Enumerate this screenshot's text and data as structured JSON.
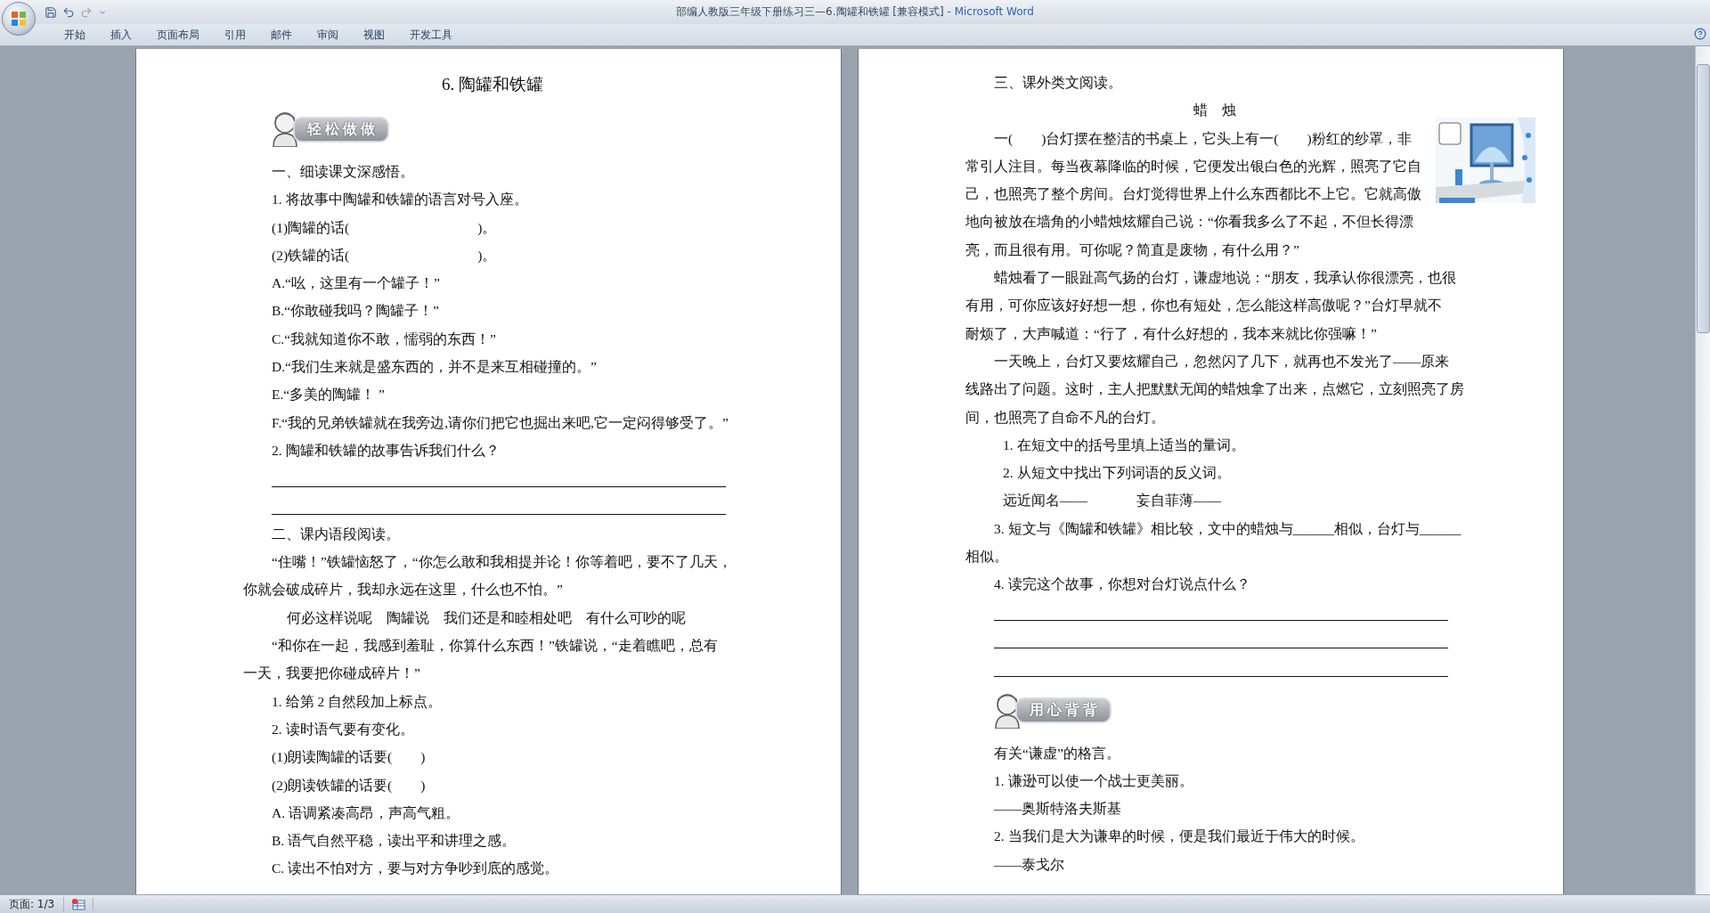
{
  "window": {
    "title": "部编人教版三年级下册练习三—6.陶罐和铁罐 [兼容模式]",
    "app_name": " - Microsoft Word"
  },
  "ribbon_tabs": [
    "开始",
    "插入",
    "页面布局",
    "引用",
    "邮件",
    "审阅",
    "视图",
    "开发工具"
  ],
  "pages": [
    {
      "blocks": [
        {
          "kind": "title",
          "text": "6. 陶罐和铁罐"
        },
        {
          "kind": "banner",
          "text": "轻松做做"
        },
        {
          "kind": "line",
          "text": "一、细读课文深感悟。"
        },
        {
          "kind": "line",
          "text": "1. 将故事中陶罐和铁罐的语言对号入座。"
        },
        {
          "kind": "line",
          "text": "(1)陶罐的话(　　　　　　　　　)。"
        },
        {
          "kind": "line",
          "text": "(2)铁罐的话(　　　　　　　　　)。"
        },
        {
          "kind": "line",
          "text": "A.“吆，这里有一个罐子！”"
        },
        {
          "kind": "line",
          "text": "B.“你敢碰我吗？陶罐子！”"
        },
        {
          "kind": "line",
          "text": "C.“我就知道你不敢，懦弱的东西！”"
        },
        {
          "kind": "line",
          "text": "D.“我们生来就是盛东西的，并不是来互相碰撞的。”"
        },
        {
          "kind": "line",
          "text": "E.“多美的陶罐！ ”"
        },
        {
          "kind": "line",
          "text": "F.“我的兄弟铁罐就在我旁边,请你们把它也掘出来吧,它一定闷得够受了。”"
        },
        {
          "kind": "line",
          "text": "2. 陶罐和铁罐的故事告诉我们什么？"
        },
        {
          "kind": "answer"
        },
        {
          "kind": "answer"
        },
        {
          "kind": "line",
          "text": "二、课内语段阅读。"
        },
        {
          "kind": "para",
          "lines": [
            "“住嘴！”铁罐恼怒了，“你怎么敢和我相提并论！你等着吧，要不了几天，",
            "你就会破成碎片，我却永远在这里，什么也不怕。”"
          ]
        },
        {
          "kind": "indented",
          "text": "何必这样说呢　陶罐说　我们还是和睦相处吧　有什么可吵的呢"
        },
        {
          "kind": "para",
          "lines": [
            "“和你在一起，我感到羞耻，你算什么东西！”铁罐说，“走着瞧吧，总有",
            "一天，我要把你碰成碎片！”"
          ]
        },
        {
          "kind": "line",
          "text": "1. 给第 2 自然段加上标点。"
        },
        {
          "kind": "line",
          "text": "2. 读时语气要有变化。"
        },
        {
          "kind": "line",
          "text": "(1)朗读陶罐的话要(　　)"
        },
        {
          "kind": "line",
          "text": "(2)朗读铁罐的话要(　　)"
        },
        {
          "kind": "line",
          "text": "A. 语调紧凑高昂，声高气粗。"
        },
        {
          "kind": "line",
          "text": "B. 语气自然平稳，读出平和讲理之感。"
        },
        {
          "kind": "line",
          "text": "C. 读出不怕对方，要与对方争吵到底的感觉。"
        }
      ]
    },
    {
      "blocks": [
        {
          "kind": "line",
          "text": "三、课外类文阅读。"
        },
        {
          "kind": "subtitle",
          "text": "蜡　烛"
        },
        {
          "kind": "picture_para",
          "lines": [
            "一(　　)台灯摆在整洁的书桌上，它头上有一(　　)粉红的纱罩，非",
            "常引人注目。每当夜幕降临的时候，它便发出银白色的光辉，照亮了它自",
            "己，也照亮了整个房间。台灯觉得世界上什么东西都比不上它。它就高傲",
            "地向被放在墙角的小蜡烛炫耀自己说：“你看我多么了不起，不但长得漂",
            "亮，而且很有用。可你呢？简直是废物，有什么用？”"
          ]
        },
        {
          "kind": "para",
          "lines": [
            "蜡烛看了一眼趾高气扬的台灯，谦虚地说：“朋友，我承认你很漂亮，也很",
            "有用，可你应该好好想一想，你也有短处，怎么能这样高傲呢？”台灯早就不",
            "耐烦了，大声喊道：“行了，有什么好想的，我本来就比你强嘛！”"
          ]
        },
        {
          "kind": "para",
          "lines": [
            "一天晚上，台灯又要炫耀自己，忽然闪了几下，就再也不发光了——原来",
            "线路出了问题。这时，主人把默默无闻的蜡烛拿了出来，点燃它，立刻照亮了房",
            "间，也照亮了自命不凡的台灯。"
          ]
        },
        {
          "kind": "item",
          "text": "1. 在短文中的括号里填上适当的量词。"
        },
        {
          "kind": "item",
          "text": "2. 从短文中找出下列词语的反义词。"
        },
        {
          "kind": "pair",
          "texts": [
            "远近闻名——",
            "妄自菲薄——"
          ]
        },
        {
          "kind": "para",
          "lines": [
            "3. 短文与《陶罐和铁罐》相比较，文中的蜡烛与______相似，台灯与______",
            "相似。"
          ]
        },
        {
          "kind": "line",
          "text": "4. 读完这个故事，你想对台灯说点什么？"
        },
        {
          "kind": "answer"
        },
        {
          "kind": "answer"
        },
        {
          "kind": "answer"
        },
        {
          "kind": "banner",
          "text": "用心背背"
        },
        {
          "kind": "line",
          "text": "有关“谦虚”的格言。"
        },
        {
          "kind": "line",
          "text": "1. 谦逊可以使一个战士更美丽。"
        },
        {
          "kind": "line",
          "text": "——奥斯特洛夫斯基"
        },
        {
          "kind": "line",
          "text": "2. 当我们是大为谦卑的时候，便是我们最近于伟大的时候。"
        },
        {
          "kind": "line",
          "text": "——泰戈尔"
        }
      ]
    }
  ],
  "status_bar": {
    "page": "页面: 1/3"
  }
}
